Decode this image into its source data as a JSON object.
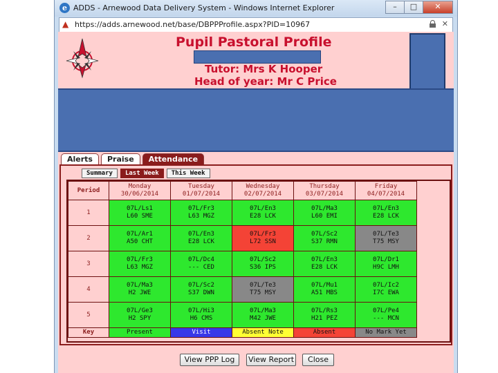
{
  "window": {
    "title": "ADDS - Arnewood Data Delivery System - Windows Internet Explorer",
    "controls": [
      "–",
      "□",
      "✕"
    ]
  },
  "address": {
    "url": "https://adds.arnewood.net/base/DBPPProfile.aspx?PID=10967"
  },
  "profile": {
    "title": "Pupil Pastoral Profile",
    "tutor": "Tutor: Mrs K Hooper",
    "head_of_year": "Head of year: Mr C Price"
  },
  "tabs": [
    {
      "label": "Alerts",
      "active": false
    },
    {
      "label": "Praise",
      "active": false
    },
    {
      "label": "Attendance",
      "active": true
    }
  ],
  "subtabs": [
    {
      "label": "Summary",
      "active": false
    },
    {
      "label": "Last Week",
      "active": true
    },
    {
      "label": "This Week",
      "active": false
    }
  ],
  "attendance": {
    "period_header": "Period",
    "days": [
      {
        "day": "Monday",
        "date": "30/06/2014"
      },
      {
        "day": "Tuesday",
        "date": "01/07/2014"
      },
      {
        "day": "Wednesday",
        "date": "02/07/2014"
      },
      {
        "day": "Thursday",
        "date": "03/07/2014"
      },
      {
        "day": "Friday",
        "date": "04/07/2014"
      }
    ],
    "rows": [
      {
        "period": "1",
        "cells": [
          {
            "line1": "07L/Ls1",
            "line2": "L60 SME",
            "status": "present"
          },
          {
            "line1": "07L/Fr3",
            "line2": "L63 MGZ",
            "status": "present"
          },
          {
            "line1": "07L/En3",
            "line2": "E28 LCK",
            "status": "present"
          },
          {
            "line1": "07L/Ma3",
            "line2": "L60 EMI",
            "status": "present"
          },
          {
            "line1": "07L/En3",
            "line2": "E28 LCK",
            "status": "present"
          }
        ]
      },
      {
        "period": "2",
        "cells": [
          {
            "line1": "07L/Ar1",
            "line2": "A50 CHT",
            "status": "present"
          },
          {
            "line1": "07L/En3",
            "line2": "E28 LCK",
            "status": "present"
          },
          {
            "line1": "07L/Fr3",
            "line2": "L72 SSN",
            "status": "absent"
          },
          {
            "line1": "07L/Sc2",
            "line2": "S37 RMN",
            "status": "present"
          },
          {
            "line1": "07L/Te3",
            "line2": "T75 MSY",
            "status": "nomark"
          }
        ]
      },
      {
        "period": "3",
        "cells": [
          {
            "line1": "07L/Fr3",
            "line2": "L63 MGZ",
            "status": "present"
          },
          {
            "line1": "07L/Dc4",
            "line2": "--- CED",
            "status": "present"
          },
          {
            "line1": "07L/Sc2",
            "line2": "S36 IPS",
            "status": "present"
          },
          {
            "line1": "07L/En3",
            "line2": "E28 LCK",
            "status": "present"
          },
          {
            "line1": "07L/Dr1",
            "line2": "H9C LMH",
            "status": "present"
          }
        ]
      },
      {
        "period": "4",
        "cells": [
          {
            "line1": "07L/Ma3",
            "line2": "H2 JWE",
            "status": "present"
          },
          {
            "line1": "07L/Sc2",
            "line2": "S37 DWN",
            "status": "present"
          },
          {
            "line1": "07L/Te3",
            "line2": "T75 MSY",
            "status": "nomark"
          },
          {
            "line1": "07L/Mu1",
            "line2": "A51 MBS",
            "status": "present"
          },
          {
            "line1": "07L/Ic2",
            "line2": "I7C EWA",
            "status": "present"
          }
        ]
      },
      {
        "period": "5",
        "cells": [
          {
            "line1": "07L/Ge3",
            "line2": "H2 SPY",
            "status": "present"
          },
          {
            "line1": "07L/Hi3",
            "line2": "H6 CMS",
            "status": "present"
          },
          {
            "line1": "07L/Ma3",
            "line2": "M42 JWE",
            "status": "present"
          },
          {
            "line1": "07L/Rs3",
            "line2": "H21 PEZ",
            "status": "present"
          },
          {
            "line1": "07L/Pe4",
            "line2": "--- MCN",
            "status": "present"
          }
        ]
      }
    ],
    "key_label": "Key",
    "key": [
      {
        "label": "Present",
        "status": "present"
      },
      {
        "label": "Visit",
        "status": "visit"
      },
      {
        "label": "Absent Note",
        "status": "absnote"
      },
      {
        "label": "Absent",
        "status": "absent"
      },
      {
        "label": "No Mark Yet",
        "status": "nomark"
      }
    ]
  },
  "buttons": {
    "view_ppp_log": "View PPP Log",
    "view_report": "View Report",
    "close": "Close"
  },
  "colors": {
    "background": "#ffd0d0",
    "title_red": "#c8102e",
    "tab_active": "#8a1c1c",
    "present": "#2ee82e",
    "visit": "#3838e8",
    "absent_note": "#ffff33",
    "absent": "#f44336",
    "no_mark": "#888888",
    "redaction": "#4a6fb0"
  },
  "icons": {
    "browser": "ie-icon",
    "site": "arnewood-logo-icon",
    "lock": "lock-icon"
  }
}
